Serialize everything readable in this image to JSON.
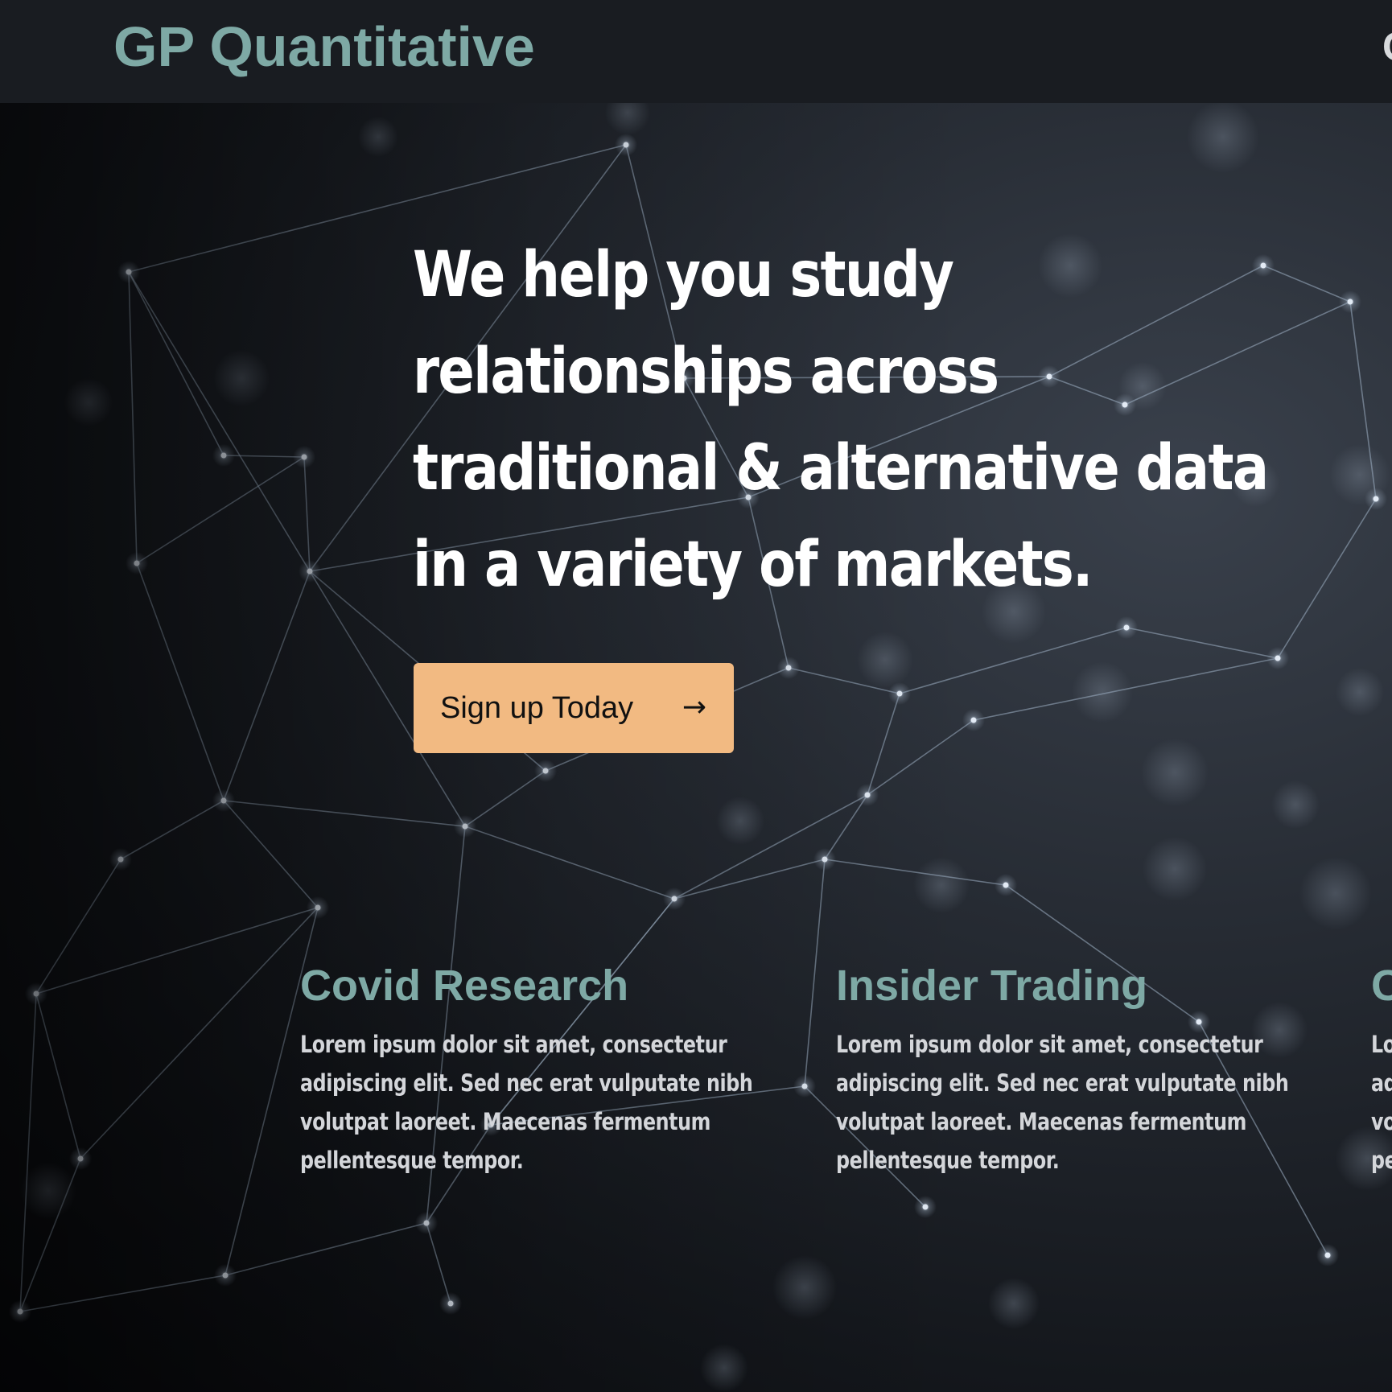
{
  "header": {
    "brand": "GP Quantitative",
    "nav_cut_label": "C"
  },
  "hero": {
    "headline_lines": [
      "We help you study",
      "relationships across",
      "traditional & alternative data",
      "in a variety of markets."
    ],
    "cta_label": "Sign up Today",
    "cta_arrow": "→"
  },
  "features": [
    {
      "title": "Covid Research",
      "body_lines": [
        "Lorem ipsum dolor sit amet, consectetur",
        "adipiscing elit. Sed nec erat vulputate nibh",
        "volutpat laoreet. Maecenas fermentum",
        "pellentesque tempor."
      ]
    },
    {
      "title": "Insider Trading",
      "body_lines": [
        "Lorem ipsum dolor sit amet, consectetur",
        "adipiscing elit. Sed nec erat vulputate nibh",
        "volutpat laoreet. Maecenas fermentum",
        "pellentesque tempor."
      ]
    },
    {
      "title": "C",
      "body_lines": [
        "Lo",
        "ad",
        "vo",
        "pe"
      ]
    }
  ],
  "colors": {
    "header_bg": "#191c21",
    "brand_accent": "#7ea9a5",
    "cta_bg": "#f2ba82",
    "headline": "#ffffff",
    "body_text": "#d4d6da"
  },
  "icons": {
    "cta_arrow": "right-arrow-icon"
  }
}
